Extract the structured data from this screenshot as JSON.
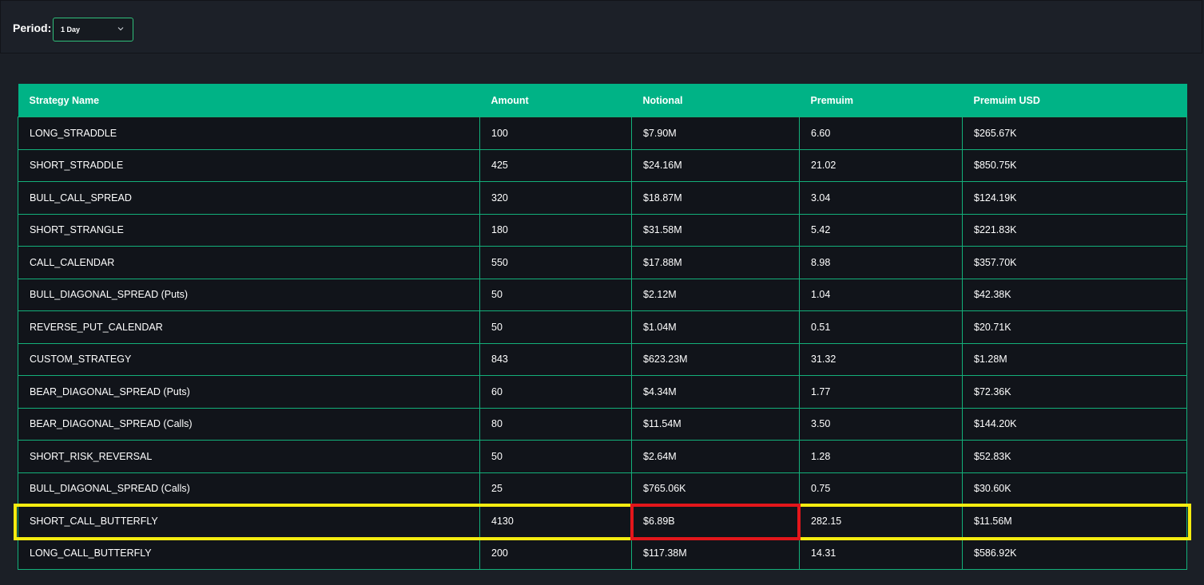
{
  "filter": {
    "label": "Period:",
    "selected": "1 Day"
  },
  "table": {
    "columns": [
      "Strategy Name",
      "Amount",
      "Notional",
      "Premuim",
      "Premuim USD"
    ],
    "rows": [
      [
        "LONG_STRADDLE",
        "100",
        "$7.90M",
        "6.60",
        "$265.67K"
      ],
      [
        "SHORT_STRADDLE",
        "425",
        "$24.16M",
        "21.02",
        "$850.75K"
      ],
      [
        "BULL_CALL_SPREAD",
        "320",
        "$18.87M",
        "3.04",
        "$124.19K"
      ],
      [
        "SHORT_STRANGLE",
        "180",
        "$31.58M",
        "5.42",
        "$221.83K"
      ],
      [
        "CALL_CALENDAR",
        "550",
        "$17.88M",
        "8.98",
        "$357.70K"
      ],
      [
        "BULL_DIAGONAL_SPREAD (Puts)",
        "50",
        "$2.12M",
        "1.04",
        "$42.38K"
      ],
      [
        "REVERSE_PUT_CALENDAR",
        "50",
        "$1.04M",
        "0.51",
        "$20.71K"
      ],
      [
        "CUSTOM_STRATEGY",
        "843",
        "$623.23M",
        "31.32",
        "$1.28M"
      ],
      [
        "BEAR_DIAGONAL_SPREAD (Puts)",
        "60",
        "$4.34M",
        "1.77",
        "$72.36K"
      ],
      [
        "BEAR_DIAGONAL_SPREAD (Calls)",
        "80",
        "$11.54M",
        "3.50",
        "$144.20K"
      ],
      [
        "SHORT_RISK_REVERSAL",
        "50",
        "$2.64M",
        "1.28",
        "$52.83K"
      ],
      [
        "BULL_DIAGONAL_SPREAD (Calls)",
        "25",
        "$765.06K",
        "0.75",
        "$30.60K"
      ],
      [
        "SHORT_CALL_BUTTERFLY",
        "4130",
        "$6.89B",
        "282.15",
        "$11.56M"
      ],
      [
        "LONG_CALL_BUTTERFLY",
        "200",
        "$117.38M",
        "14.31",
        "$586.92K"
      ]
    ]
  },
  "highlights": {
    "row_color": "#f5ec10",
    "cell_color": "#e3161b"
  },
  "colors": {
    "header_bg": "#00b386",
    "row_bg": "#11141a",
    "border": "#13b07a",
    "page_bg": "#1b1f26"
  },
  "icons": {
    "select_caret": "chevron-down-icon"
  }
}
